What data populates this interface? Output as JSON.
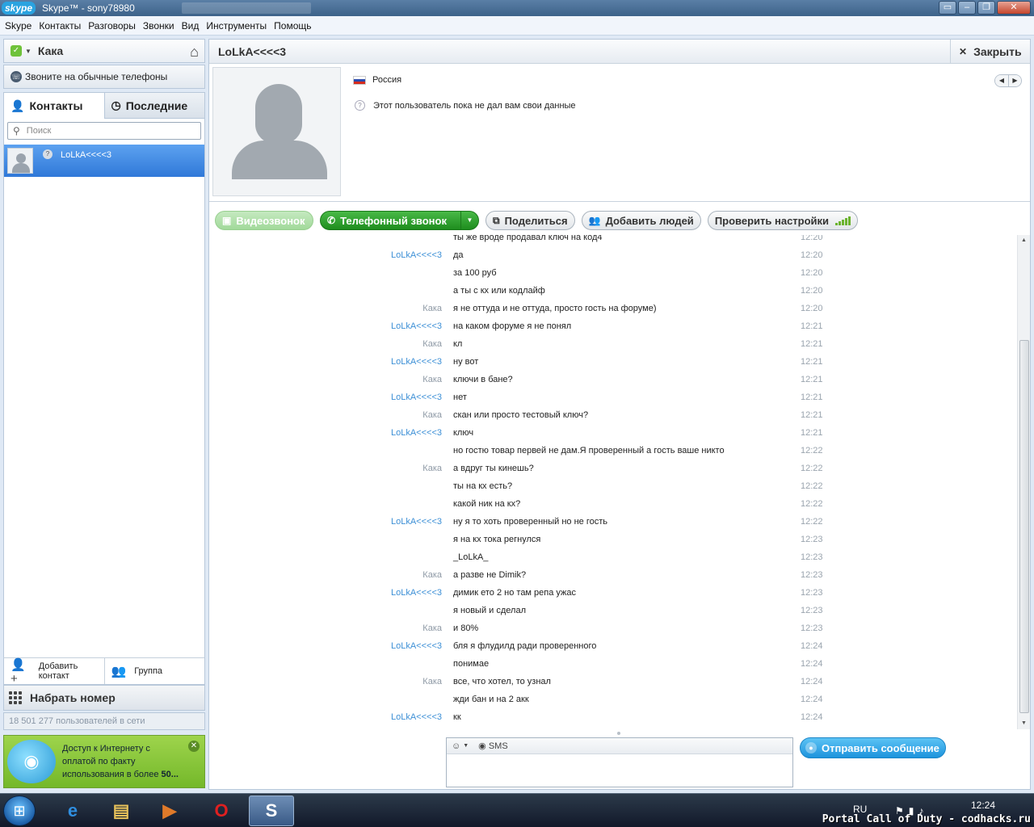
{
  "window": {
    "logo": "skype",
    "title": "Skype™ - sony78980",
    "buttons": [
      "minimize-tile",
      "minimize",
      "restore",
      "close"
    ]
  },
  "menu": [
    "Skype",
    "Контакты",
    "Разговоры",
    "Звонки",
    "Вид",
    "Инструменты",
    "Помощь"
  ],
  "sidebar": {
    "user_name": "Кака",
    "status_icon": "online-check-icon",
    "call_phones": "Звоните на обычные телефоны",
    "tabs": [
      {
        "label": "Контакты",
        "icon": "person-icon",
        "active": true
      },
      {
        "label": "Последние",
        "icon": "clock-icon",
        "active": false
      }
    ],
    "search_placeholder": "Поиск",
    "contacts": [
      {
        "name": "LoLkA<<<<3",
        "selected": true
      }
    ],
    "add_contact": "Добавить контакт",
    "group": "Группа",
    "dial": "Набрать номер",
    "users_online": "18 501 277 пользователей в сети",
    "promo": {
      "line1": "Доступ к Интернету с",
      "line2": "оплатой по факту",
      "line3_prefix": "использования в более ",
      "line3_bold": "50..."
    }
  },
  "chat": {
    "contact_name": "LoLkA<<<<3",
    "close_label": "Закрыть",
    "country": "Россия",
    "profile_note": "Этот пользователь пока не дал вам свои данные",
    "actions": {
      "video": "Видеозвонок",
      "phone": "Телефонный звонок",
      "share": "Поделиться",
      "add_people": "Добавить людей",
      "check_settings": "Проверить настройки"
    },
    "messages": [
      {
        "author": "",
        "text": "ты же вроде продавал ключ на код4",
        "time": "12:20"
      },
      {
        "author": "LoLkA<<<<3",
        "text": "да",
        "time": "12:20"
      },
      {
        "author": "",
        "text": "за 100 руб",
        "time": "12:20"
      },
      {
        "author": "",
        "text": "а ты с кх или кодлайф",
        "time": "12:20"
      },
      {
        "author": "Кака",
        "text": "я не оттуда и не оттуда, просто гость на форуме)",
        "time": "12:20"
      },
      {
        "author": "LoLkA<<<<3",
        "text": "на каком форуме я не понял",
        "time": "12:21"
      },
      {
        "author": "Кака",
        "text": "кл",
        "time": "12:21"
      },
      {
        "author": "LoLkA<<<<3",
        "text": "ну вот",
        "time": "12:21"
      },
      {
        "author": "Кака",
        "text": "ключи в бане?",
        "time": "12:21"
      },
      {
        "author": "LoLkA<<<<3",
        "text": "нет",
        "time": "12:21"
      },
      {
        "author": "Кака",
        "text": "скан или просто тестовый ключ?",
        "time": "12:21"
      },
      {
        "author": "LoLkA<<<<3",
        "text": "ключ",
        "time": "12:21"
      },
      {
        "author": "",
        "text": "но гостю товар первей не дам.Я проверенный а гость ваше никто",
        "time": "12:22"
      },
      {
        "author": "Кака",
        "text": "а вдруг ты кинешь?",
        "time": "12:22"
      },
      {
        "author": "",
        "text": "ты на кх есть?",
        "time": "12:22"
      },
      {
        "author": "",
        "text": "какой ник на кх?",
        "time": "12:22"
      },
      {
        "author": "LoLkA<<<<3",
        "text": "ну я то хоть проверенный но не гость",
        "time": "12:22"
      },
      {
        "author": "",
        "text": "я на кх тока регнулся",
        "time": "12:23"
      },
      {
        "author": "",
        "text": "_LoLkA_",
        "time": "12:23"
      },
      {
        "author": "Кака",
        "text": "а разве не Dimik?",
        "time": "12:23"
      },
      {
        "author": "LoLkA<<<<3",
        "text": "димик ето 2 но там репа ужас",
        "time": "12:23"
      },
      {
        "author": "",
        "text": "я новый и сделал",
        "time": "12:23"
      },
      {
        "author": "Кака",
        "text": "и 80%",
        "time": "12:23"
      },
      {
        "author": "LoLkA<<<<3",
        "text": "бля я флудилд ради проверенного",
        "time": "12:24"
      },
      {
        "author": "",
        "text": "понимае",
        "time": "12:24"
      },
      {
        "author": "Кака",
        "text": "все, что хотел, то узнал",
        "time": "12:24"
      },
      {
        "author": "",
        "text": "жди бан и на 2 акк",
        "time": "12:24"
      },
      {
        "author": "LoLkA<<<<3",
        "text": "кк",
        "time": "12:24"
      }
    ],
    "composer": {
      "emoticon": "☺",
      "sms": "SMS"
    },
    "send_label": "Отправить сообщение"
  },
  "taskbar": {
    "lang": "RU",
    "time": "12:24",
    "watermark": "Portal Call of Duty - codhacks.ru"
  },
  "colors": {
    "lolka": "#3c8fd6",
    "kaka": "#8e99a5",
    "phone_green": "#1e8d1e",
    "send_blue": "#1c93dc",
    "selected_contact": "#2f78d8"
  }
}
